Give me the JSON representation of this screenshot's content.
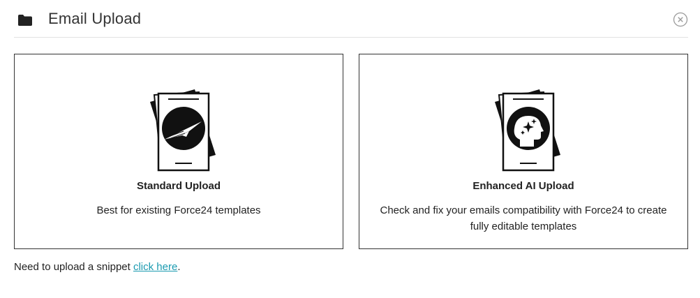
{
  "header": {
    "title": "Email Upload",
    "icon": "folder-icon",
    "close_icon": "close-circle-icon"
  },
  "cards": [
    {
      "title": "Standard Upload",
      "description": "Best for existing Force24 templates",
      "icon": "paper-plane-document-icon"
    },
    {
      "title": "Enhanced AI Upload",
      "description": "Check and fix your emails compatibility with Force24 to create fully editable templates",
      "icon": "ai-brain-document-icon"
    }
  ],
  "footer": {
    "text": "Need to upload a snippet ",
    "link_label": "click here",
    "suffix": "."
  },
  "colors": {
    "link": "#1a9ab0",
    "border": "#333333",
    "divider": "#e2e2e2"
  }
}
